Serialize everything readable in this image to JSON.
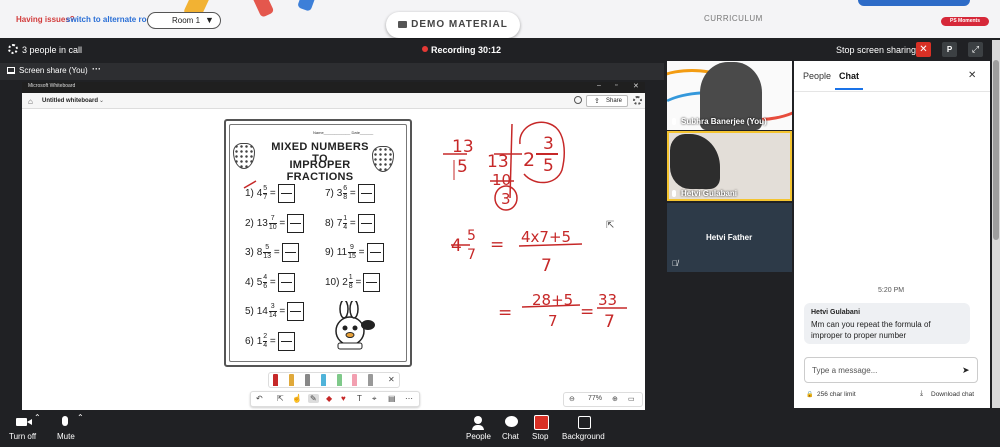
{
  "topbar": {
    "issues_text": "Having issues?",
    "switch_link": "switch to alternate room",
    "room_label": "Room 1",
    "room_arrow": "▼",
    "demo_button": "DEMO MATERIAL",
    "curriculum": "CURRICULUM",
    "moments_badge": "PS Moments"
  },
  "call": {
    "people_in_call": "3 people in call",
    "recording_label": "Recording 30:12",
    "stop_sharing": "Stop screen sharing",
    "profile_initial": "P"
  },
  "screenshare": {
    "label": "Screen share (You)",
    "more": "···",
    "app_title": "Microsoft Whiteboard",
    "board_name": "Untitled whiteboard",
    "share_button": "Share",
    "zoom_level": "77%"
  },
  "worksheet": {
    "name_date": "Name____________ Date______",
    "title_line1": "MIXED NUMBERS TO",
    "title_line2": "IMPROPER FRACTIONS",
    "problems": [
      {
        "label": "1)",
        "whole": "4",
        "num": "5",
        "den": "7"
      },
      {
        "label": "2)",
        "whole": "13",
        "num": "7",
        "den": "10"
      },
      {
        "label": "3)",
        "whole": "8",
        "num": "5",
        "den": "13"
      },
      {
        "label": "4)",
        "whole": "5",
        "num": "4",
        "den": "6"
      },
      {
        "label": "5)",
        "whole": "14",
        "num": "3",
        "den": "14"
      },
      {
        "label": "6)",
        "whole": "1",
        "num": "2",
        "den": "4"
      },
      {
        "label": "7)",
        "whole": "3",
        "num": "6",
        "den": "8"
      },
      {
        "label": "8)",
        "whole": "7",
        "num": "1",
        "den": "4"
      },
      {
        "label": "9)",
        "whole": "11",
        "num": "9",
        "den": "15"
      },
      {
        "label": "10)",
        "whole": "2",
        "num": "1",
        "den": "8"
      }
    ]
  },
  "handwriting": {
    "f1_num": "13",
    "f1_den": "5",
    "div_dividend": "13",
    "div_product": "10",
    "div_remainder": "3",
    "mixed_whole": "2",
    "mixed_num": "3",
    "mixed_den": "5",
    "eq2_whole": "4",
    "eq2_num": "5",
    "eq2_den": "7",
    "eq2_equals": "=",
    "eq2_rhs_num": "4x7+5",
    "eq2_rhs_den": "7",
    "eq3_equals1": "=",
    "eq3_num": "28+5",
    "eq3_den": "7",
    "eq3_equals2": "=",
    "eq3_res_num": "33",
    "eq3_res_den": "7"
  },
  "participants": [
    {
      "name": "Subhra Banerjee (You)"
    },
    {
      "name": "Hetvi Gulabani"
    },
    {
      "name": "Hetvi Father"
    }
  ],
  "chat": {
    "tab_people": "People",
    "tab_chat": "Chat",
    "time": "5:20 PM",
    "sender": "Hetvi Gulabani",
    "message": "Mm can you repeat the formula of improper to proper number",
    "input_placeholder": "Type a message...",
    "char_limit": "256 char limit",
    "download": "Download chat"
  },
  "controls": {
    "turn_off": "Turn off",
    "mute": "Mute",
    "people": "People",
    "chat": "Chat",
    "stop": "Stop",
    "background": "Background"
  },
  "icons": [
    "gear-icon",
    "screen-icon",
    "close-icon",
    "expand-icon",
    "mic-icon",
    "camera-icon",
    "people-icon",
    "chat-icon",
    "stop-icon",
    "background-icon",
    "send-icon",
    "lock-icon",
    "download-icon",
    "home-icon",
    "clock-icon"
  ],
  "colors": {
    "accent": "#1a73e8",
    "record": "#e53935",
    "danger": "#d93025",
    "ink": "#c62828",
    "speaker_border": "#f4c430"
  }
}
